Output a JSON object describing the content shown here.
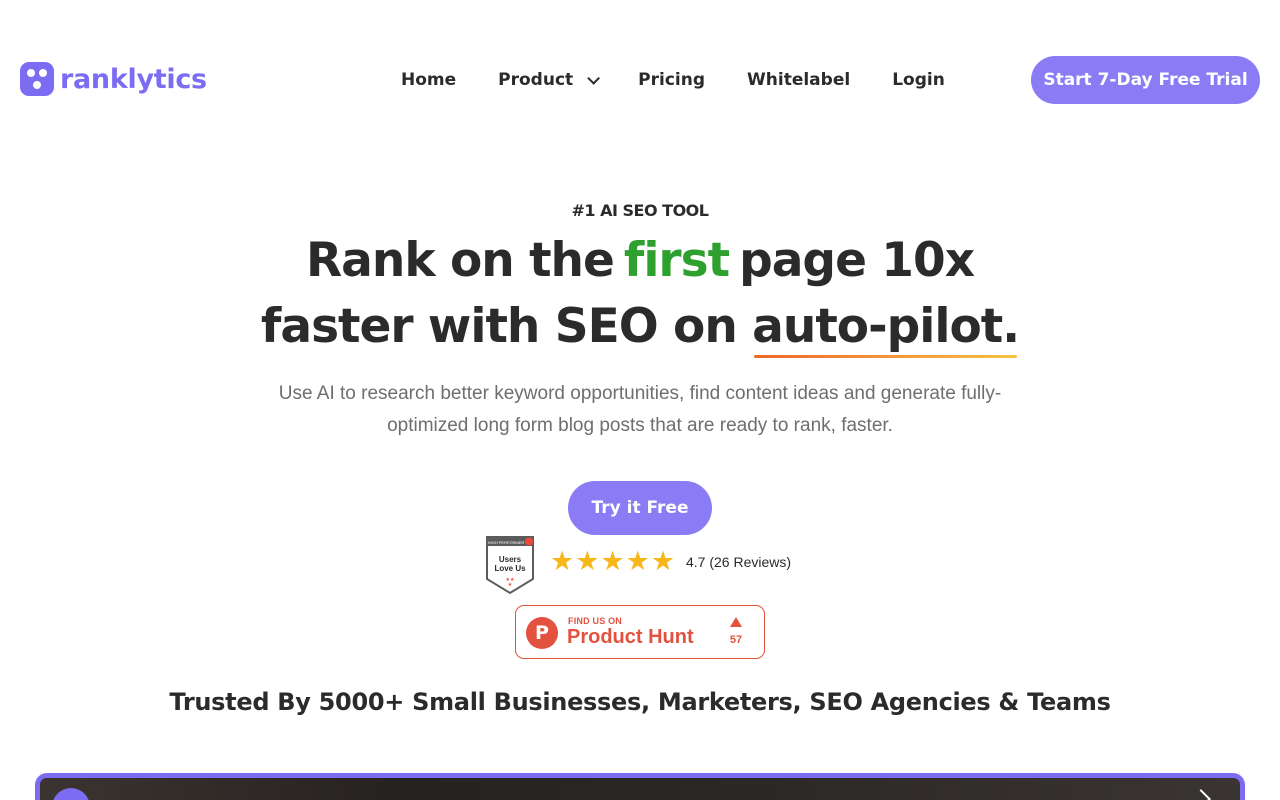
{
  "brand": {
    "name": "ranklytics",
    "color": "#7c6cf2"
  },
  "nav": {
    "items": [
      {
        "label": "Home",
        "has_dropdown": false
      },
      {
        "label": "Product",
        "has_dropdown": true,
        "icon": "chevron-down-icon"
      },
      {
        "label": "Pricing",
        "has_dropdown": false
      },
      {
        "label": "Whitelabel",
        "has_dropdown": false
      },
      {
        "label": "Login",
        "has_dropdown": false
      }
    ],
    "cta_label": "Start 7-Day Free Trial"
  },
  "hero": {
    "eyebrow": "#1 AI SEO TOOL",
    "headline_part1": "Rank on the",
    "headline_accent": "first",
    "headline_part2": "page 10x",
    "headline_part3": "faster with SEO on",
    "headline_underlined": "auto-pilot.",
    "subheading": "Use AI to research better keyword opportunities, find content ideas and generate fully-optimized long form blog posts that are ready to rank, faster.",
    "cta_label": "Try it Free"
  },
  "reviews": {
    "g2_badge": {
      "top": "HIGH PERFORMER",
      "main": "Users Love Us",
      "icon": "g2-badge-icon"
    },
    "stars": 5,
    "rating_text": "4.7 (26 Reviews)"
  },
  "product_hunt": {
    "small_text": "FIND US ON",
    "big_text": "Product Hunt",
    "logo_letter": "P",
    "upvotes": "57",
    "color": "#e2523f"
  },
  "trusted": {
    "text": "Trusted By 5000+ Small Businesses, Marketers, SEO Agencies & Teams"
  },
  "colors": {
    "accent": "#8b7cf6",
    "green": "#2ea02e",
    "star": "#f7b71b"
  }
}
